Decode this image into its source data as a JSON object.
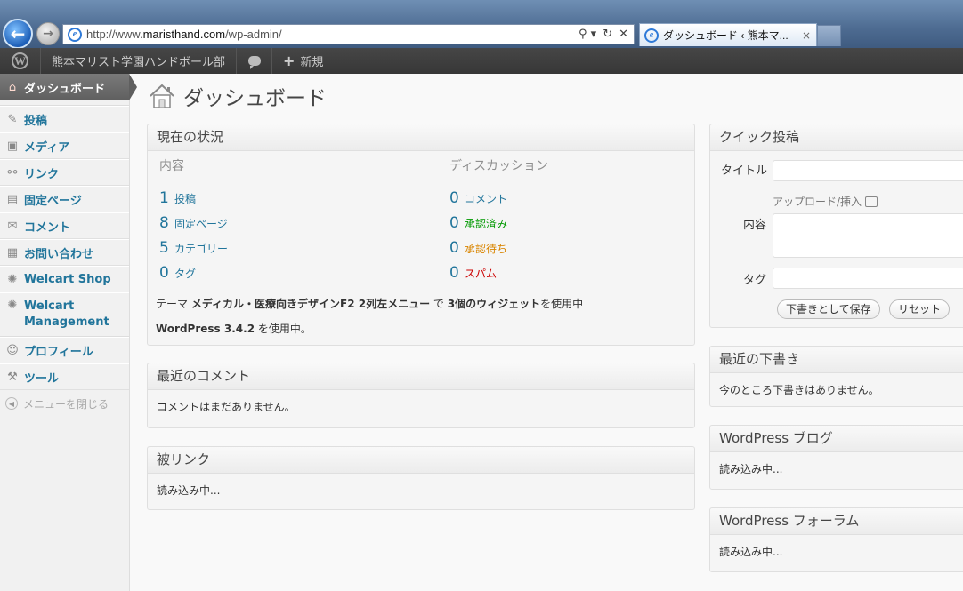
{
  "browser": {
    "url_prefix": "http://www.",
    "url_domain": "maristhand.com",
    "url_path": "/wp-admin/",
    "tab_title": "ダッシュボード ‹ 熊本マ...",
    "tab_close": "×",
    "back_glyph": "←",
    "forward_glyph": "→",
    "search_glyph": "⚲ ▾",
    "refresh_glyph": "↻",
    "stop_glyph": "✕",
    "ie_glyph": "e"
  },
  "admin_bar": {
    "site_name": "熊本マリスト学園ハンドボール部",
    "new_label": "新規",
    "wp_glyph": "W"
  },
  "sidebar": {
    "items": [
      {
        "label": "ダッシュボード",
        "icon": "home-icon",
        "glyph": "⌂"
      },
      {
        "label": "投稿",
        "icon": "pin-icon",
        "glyph": "✎"
      },
      {
        "label": "メディア",
        "icon": "media-icon",
        "glyph": "▣"
      },
      {
        "label": "リンク",
        "icon": "link-icon",
        "glyph": "⚯"
      },
      {
        "label": "固定ページ",
        "icon": "page-icon",
        "glyph": "▤"
      },
      {
        "label": "コメント",
        "icon": "comment-icon",
        "glyph": "✉"
      },
      {
        "label": "お問い合わせ",
        "icon": "contact-icon",
        "glyph": "▦"
      },
      {
        "label": "Welcart Shop",
        "icon": "gear-icon",
        "glyph": "✺"
      },
      {
        "label": "Welcart Management",
        "icon": "gear-icon",
        "glyph": "✺"
      },
      {
        "label": "プロフィール",
        "icon": "users-icon",
        "glyph": "☺"
      },
      {
        "label": "ツール",
        "icon": "tools-icon",
        "glyph": "⚒"
      }
    ],
    "collapse_label": "メニューを閉じる",
    "collapse_glyph": "◀"
  },
  "page": {
    "title": "ダッシュボード"
  },
  "right_now": {
    "title": "現在の状況",
    "content_heading": "内容",
    "discussion_heading": "ディスカッション",
    "content_rows": [
      {
        "num": "1",
        "label": "投稿"
      },
      {
        "num": "8",
        "label": "固定ページ"
      },
      {
        "num": "5",
        "label": "カテゴリー"
      },
      {
        "num": "0",
        "label": "タグ"
      }
    ],
    "discussion_rows": [
      {
        "num": "0",
        "label": "コメント"
      },
      {
        "num": "0",
        "label": "承認済み"
      },
      {
        "num": "0",
        "label": "承認待ち"
      },
      {
        "num": "0",
        "label": "スパム"
      }
    ],
    "theme_prefix": "テーマ",
    "theme_name": "メディカル・医療向きデザインF2 2列左メニュー",
    "theme_mid": "で",
    "widget_count": "3個のウィジェット",
    "theme_suffix": "を使用中",
    "wp_version": "WordPress 3.4.2",
    "version_suffix": "を使用中。"
  },
  "recent_comments": {
    "title": "最近のコメント",
    "body": "コメントはまだありません。"
  },
  "incoming_links": {
    "title": "被リンク",
    "body": "読み込み中..."
  },
  "quick_press": {
    "title": "クイック投稿",
    "title_label": "タイトル",
    "upload_label": "アップロード/挿入",
    "content_label": "内容",
    "tags_label": "タグ",
    "save_draft": "下書きとして保存",
    "reset": "リセット"
  },
  "recent_drafts": {
    "title": "最近の下書き",
    "body": "今のところ下書きはありません。"
  },
  "wp_blog": {
    "title": "WordPress ブログ",
    "body": "読み込み中..."
  },
  "wp_forum": {
    "title": "WordPress フォーラム",
    "body": "読み込み中..."
  },
  "colors": {
    "link": "#21759b",
    "approved": "#009900",
    "pending": "#d98500",
    "spam": "#cc0000",
    "admin_bar": "#464646"
  }
}
